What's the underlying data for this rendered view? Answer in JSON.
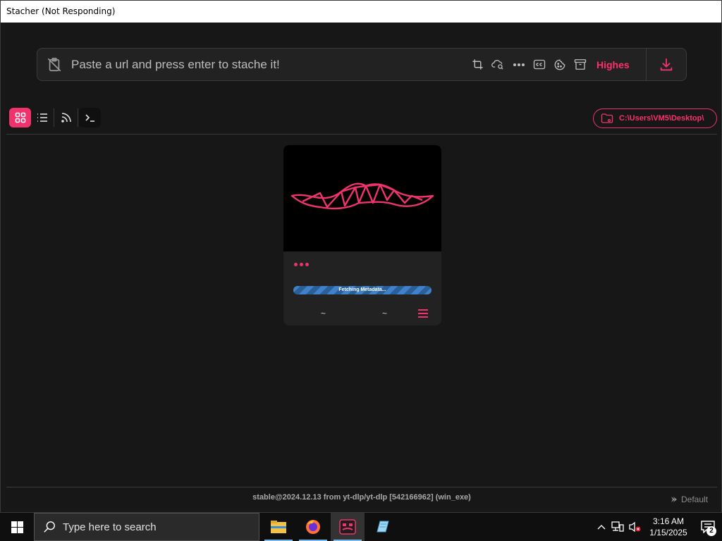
{
  "window": {
    "title": "Stacher (Not Responding)"
  },
  "urlbar": {
    "placeholder": "Paste a url and press enter to stache it!",
    "quality": "Highes",
    "icons": [
      "crop-icon",
      "cloud-search-icon",
      "more-icon",
      "captions-icon",
      "cookie-icon",
      "archive-icon",
      "download-icon"
    ]
  },
  "toolbar": {
    "views": [
      "grid-view-icon",
      "list-view-icon",
      "rss-icon",
      "terminal-icon"
    ],
    "download_path": "C:\\Users\\VM5\\Desktop\\"
  },
  "card": {
    "progress_text": "Fetching Metadata...",
    "left_meta": "~",
    "right_meta": "~"
  },
  "status": {
    "version_text": "stable@2024.12.13 from yt-dlp/yt-dlp [542166962] (win_exe)",
    "profile": "Default"
  },
  "taskbar": {
    "search_placeholder": "Type here to search",
    "time": "3:16 AM",
    "date": "1/15/2025",
    "notifications": "2"
  },
  "colors": {
    "accent": "#f0336c",
    "background": "#171717"
  }
}
